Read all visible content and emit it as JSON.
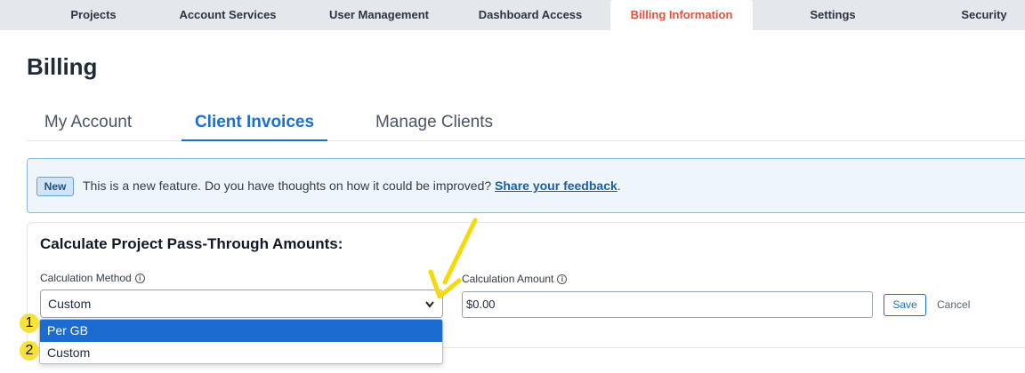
{
  "topnav": {
    "items": [
      {
        "label": "Projects"
      },
      {
        "label": "Account Services"
      },
      {
        "label": "User Management"
      },
      {
        "label": "Dashboard Access"
      },
      {
        "label": "Billing Information"
      },
      {
        "label": "Settings"
      },
      {
        "label": "Security"
      }
    ],
    "active": "Billing Information"
  },
  "page": {
    "title": "Billing"
  },
  "subtabs": {
    "items": [
      {
        "label": "My Account"
      },
      {
        "label": "Client Invoices"
      },
      {
        "label": "Manage Clients"
      }
    ],
    "active": "Client Invoices"
  },
  "banner": {
    "badge": "New",
    "message": "This is a new feature. Do you have thoughts on how it could be improved?",
    "link": "Share your feedback",
    "suffix": "."
  },
  "calc": {
    "title": "Calculate Project Pass-Through Amounts:",
    "method_label": "Calculation Method",
    "method_value": "Custom",
    "amount_label": "Calculation Amount",
    "amount_value": "$0.00",
    "save_label": "Save",
    "cancel_label": "Cancel",
    "info_glyph": "i"
  },
  "dropdown": {
    "options": [
      {
        "label": "Per GB",
        "highlighted": true
      },
      {
        "label": "Custom",
        "highlighted": false
      }
    ]
  },
  "annotations": {
    "markers": [
      "1",
      "2"
    ],
    "arrow_color": "#f5d90a"
  },
  "colors": {
    "accent": "#1a6fd1",
    "active_nav": "#e0533b",
    "banner_bg": "#eef6fc",
    "option_highlight": "#1c6bd0"
  }
}
